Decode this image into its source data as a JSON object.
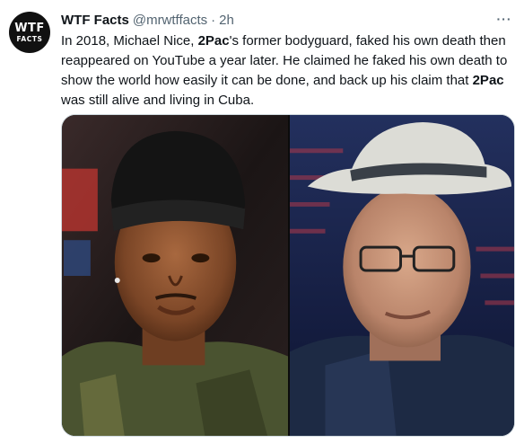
{
  "account": {
    "name": "WTF Facts",
    "handle": "@mrwtffacts",
    "separator": "·",
    "time": "2h",
    "avatar_line1": "WTF",
    "avatar_line2": "FACTS"
  },
  "more_label": "···",
  "tweet_text": [
    {
      "text": "In 2018, Michael Nice, ",
      "bold": false
    },
    {
      "text": "2Pac",
      "bold": true
    },
    {
      "text": "'s former bodyguard, faked his own death then reappeared on YouTube a year later. He claimed he faked his own death to show the world how easily it can be done, and back up his claim that ",
      "bold": false
    },
    {
      "text": "2Pac",
      "bold": true
    },
    {
      "text": " was still alive and living in Cuba.",
      "bold": false
    }
  ],
  "media": {
    "left_photo_icon": "photo-portrait",
    "right_photo_icon": "photo-portrait",
    "colors": {
      "left_bg": "#1a1414",
      "right_bg": "#10182a",
      "border": "#cfd9de",
      "text_secondary": "#536471"
    }
  }
}
